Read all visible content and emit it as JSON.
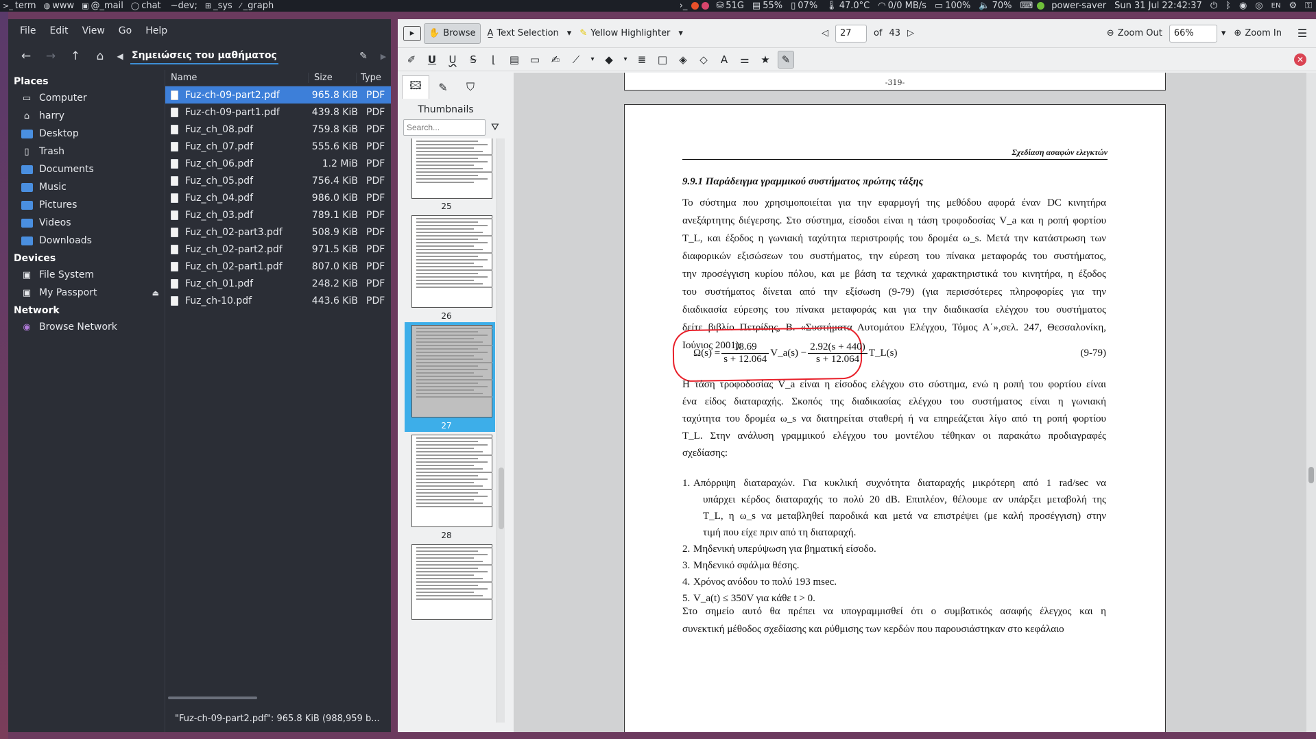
{
  "topbar": {
    "workspaces": [
      {
        "icon": ">_",
        "label": "term"
      },
      {
        "icon": "◍",
        "label": "www"
      },
      {
        "icon": "▣",
        "label": "@_mail"
      },
      {
        "icon": "◯",
        "label": "chat"
      },
      {
        "icon": "",
        "label": "~dev;"
      },
      {
        "icon": "⊞",
        "label": "_sys"
      },
      {
        "icon": "⁄",
        "label": "_graph"
      }
    ],
    "stats": {
      "disk": "51G",
      "memory": "55%",
      "cpu": "07%",
      "temp": "47.0°C",
      "net": "0/0 MB/s",
      "battery": "100%",
      "volume": "70%",
      "power_profile": "power-saver",
      "datetime": "Sun 31 Jul 22:42:37",
      "keyboard": "EN"
    }
  },
  "file_manager": {
    "menu": [
      "File",
      "Edit",
      "View",
      "Go",
      "Help"
    ],
    "path": "Σημειώσεις του μαθήματος",
    "places_heading": "Places",
    "places": [
      {
        "label": "Computer",
        "icon": "computer-icon"
      },
      {
        "label": "harry",
        "icon": "home-icon"
      },
      {
        "label": "Desktop",
        "icon": "folder-icon"
      },
      {
        "label": "Trash",
        "icon": "trash-icon"
      },
      {
        "label": "Documents",
        "icon": "folder-icon"
      },
      {
        "label": "Music",
        "icon": "folder-icon"
      },
      {
        "label": "Pictures",
        "icon": "folder-icon"
      },
      {
        "label": "Videos",
        "icon": "folder-icon"
      },
      {
        "label": "Downloads",
        "icon": "folder-icon"
      }
    ],
    "devices_heading": "Devices",
    "devices": [
      {
        "label": "File System",
        "icon": "drive-icon"
      },
      {
        "label": "My Passport",
        "icon": "drive-icon"
      }
    ],
    "network_heading": "Network",
    "network": [
      {
        "label": "Browse Network",
        "icon": "network-icon"
      }
    ],
    "columns": {
      "name": "Name",
      "size": "Size",
      "type": "Type"
    },
    "files": [
      {
        "name": "Fuz-ch-09-part2.pdf",
        "size": "965.8 KiB",
        "type": "PDF"
      },
      {
        "name": "Fuz-ch-09-part1.pdf",
        "size": "439.8 KiB",
        "type": "PDF"
      },
      {
        "name": "Fuz_ch_08.pdf",
        "size": "759.8 KiB",
        "type": "PDF"
      },
      {
        "name": "Fuz_ch_07.pdf",
        "size": "555.6 KiB",
        "type": "PDF"
      },
      {
        "name": "Fuz_ch_06.pdf",
        "size": "1.2 MiB",
        "type": "PDF"
      },
      {
        "name": "Fuz_ch_05.pdf",
        "size": "756.4 KiB",
        "type": "PDF"
      },
      {
        "name": "Fuz_ch_04.pdf",
        "size": "986.0 KiB",
        "type": "PDF"
      },
      {
        "name": "Fuz_ch_03.pdf",
        "size": "789.1 KiB",
        "type": "PDF"
      },
      {
        "name": "Fuz_ch_02-part3.pdf",
        "size": "508.9 KiB",
        "type": "PDF"
      },
      {
        "name": "Fuz_ch_02-part2.pdf",
        "size": "971.5 KiB",
        "type": "PDF"
      },
      {
        "name": "Fuz_ch_02-part1.pdf",
        "size": "807.0 KiB",
        "type": "PDF"
      },
      {
        "name": "Fuz_ch_01.pdf",
        "size": "248.2 KiB",
        "type": "PDF"
      },
      {
        "name": "Fuz_ch-10.pdf",
        "size": "443.6 KiB",
        "type": "PDF"
      }
    ],
    "status": "\"Fuz-ch-09-part2.pdf\": 965.8 KiB (988,959 b..."
  },
  "okular": {
    "toolbar": {
      "browse": "Browse",
      "text_selection": "Text Selection",
      "highlighter": "Yellow Highlighter",
      "page": "27",
      "of": "of",
      "total_pages": "43",
      "zoom_out": "Zoom Out",
      "zoom": "66%",
      "zoom_in": "Zoom In"
    },
    "sidebar": {
      "title": "Thumbnails",
      "search_placeholder": "Search...",
      "thumb_labels": [
        "25",
        "26",
        "27",
        "28"
      ]
    },
    "prev_page_number": "-319-",
    "page": {
      "header": "Σχεδίαση ασαφών ελεγκτών",
      "section": "9.9.1    Παράδειγμα γραμμικού συστήματος πρώτης τάξης",
      "p1_lines": [
        "Το σύστημα που χρησιμοποιείται για την εφαρμογή της μεθόδου αφορά έναν DC κινητήρα",
        "ανεξάρτητης διέγερσης. Στο σύστημα, είσοδοι είναι η τάση τροφοδοσίας V_a και η ροπή φορτίου",
        "T_L, και έξοδος η γωνιακή ταχύτητα περιστροφής του δρομέα ω_s. Μετά την κατάστρωση των",
        "διαφορικών εξισώσεων του συστήματος, την εύρεση του πίνακα μεταφοράς του συστήματος,",
        "την προσέγγιση κυρίου πόλου, και με βάση τα τεχνικά χαρακτηριστικά του κινητήρα, η έξοδος",
        "του συστήματος δίνεται από την εξίσωση (9-79) (για περισσότερες πληροφορίες για την",
        "διαδικασία εύρεσης του πίνακα μεταφοράς και για την διαδικασία ελέγχου του συστήματος",
        "δείτε βιβλίο Πετρίδης, Β. «Συστήματα Αυτομάτου Ελέγχου, Τόμος Α΄»,σελ. 247, Θεσσαλονίκη,",
        "Ιούνιος 2001):"
      ],
      "eq_lhs": "Ω(s) =",
      "eq_num1": "18.69",
      "eq_den1": "s + 12.064",
      "eq_mid": "V_a(s) −",
      "eq_num2": "2.92(s + 440)",
      "eq_den2": "s + 12.064",
      "eq_rhs": "T_L(s)",
      "eq_number": "(9-79)",
      "p2_lines": [
        "Η τάση τροφοδοσίας V_a είναι η είσοδος ελέγχου στο σύστημα, ενώ η ροπή του φορτίου είναι",
        "ένα είδος διαταραχής. Σκοπός της διαδικασίας ελέγχου του συστήματος είναι η γωνιακή",
        "ταχύτητα του δρομέα ω_s να διατηρείται σταθερή ή να επηρεάζεται λίγο από τη ροπή φορτίου",
        "T_L. Στην ανάλυση γραμμικού ελέγχου του μοντέλου τέθηκαν οι παρακάτω προδιαγραφές",
        "σχεδίασης:"
      ],
      "list": [
        {
          "n": "1.",
          "lines": [
            "Απόρριψη διαταραχών. Για κυκλική συχνότητα διαταραχής μικρότερη από 1 rad/sec να",
            "υπάρχει κέρδος διαταραχής το πολύ 20 dB. Επιπλέον, θέλουμε αν υπάρξει μεταβολή της",
            "T_L, η ω_s να μεταβληθεί παροδικά και μετά να επιστρέψει (με καλή προσέγγιση) στην",
            "τιμή που είχε πριν από τη διαταραχή."
          ]
        },
        {
          "n": "2.",
          "lines": [
            "Μηδενική υπερύψωση για βηματική είσοδο."
          ]
        },
        {
          "n": "3.",
          "lines": [
            "Μηδενικό σφάλμα θέσης."
          ]
        },
        {
          "n": "4.",
          "lines": [
            "Χρόνος ανόδου το πολύ 193 msec."
          ]
        },
        {
          "n": "5.",
          "lines": [
            "V_a(t) ≤ 350V για κάθε t > 0."
          ]
        }
      ],
      "p3_lines": [
        "Στο σημείο αυτό θα πρέπει να υπογραμμισθεί ότι ο συμβατικός ασαφής έλεγχος και η",
        "συνεκτική μέθοδος σχεδίασης και ρύθμισης των κερδών που παρουσιάστηκαν στο κεφάλαιο"
      ]
    }
  }
}
